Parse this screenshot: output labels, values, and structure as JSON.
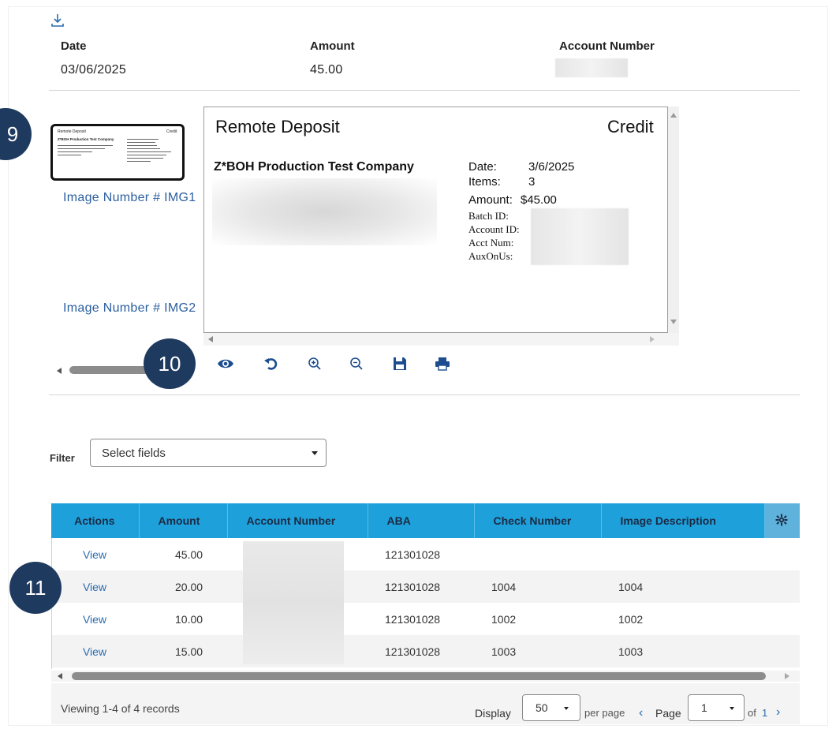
{
  "header": {
    "columns": [
      {
        "label": "Date",
        "value": "03/06/2025"
      },
      {
        "label": "Amount",
        "value": "45.00"
      },
      {
        "label": "Account Number",
        "value": ""
      }
    ]
  },
  "badges": {
    "b9": "9",
    "b10": "10",
    "b11": "11"
  },
  "images": {
    "link1": "Image Number # IMG1",
    "link2": "Image Number # IMG2"
  },
  "viewer": {
    "title": "Remote Deposit",
    "type": "Credit",
    "company": "Z*BOH Production Test Company",
    "fields": [
      {
        "label": "Date:",
        "value": "3/6/2025"
      },
      {
        "label": "Items:",
        "value": "3"
      },
      {
        "label": "Amount:",
        "value": "$45.00"
      }
    ],
    "extra_fields": [
      "Batch ID:",
      "Account ID:",
      "Acct Num:",
      "AuxOnUs:"
    ]
  },
  "thumbnail": {
    "title": "Remote Deposit",
    "type": "Credit",
    "company": "Z*BOH Production Test Company"
  },
  "toolbar": {
    "icons": [
      "eye-icon",
      "rotate-icon",
      "zoom-in-icon",
      "zoom-out-icon",
      "save-icon",
      "print-icon"
    ]
  },
  "filter": {
    "label": "Filter",
    "placeholder": "Select fields"
  },
  "table": {
    "headers": [
      "Actions",
      "Amount",
      "Account Number",
      "ABA",
      "Check Number",
      "Image Description"
    ],
    "rows": [
      {
        "action": "View",
        "amount": "45.00",
        "account": "",
        "aba": "121301028",
        "check": "",
        "desc": ""
      },
      {
        "action": "View",
        "amount": "20.00",
        "account": "",
        "aba": "121301028",
        "check": "1004",
        "desc": "1004"
      },
      {
        "action": "View",
        "amount": "10.00",
        "account": "",
        "aba": "121301028",
        "check": "1002",
        "desc": "1002"
      },
      {
        "action": "View",
        "amount": "15.00",
        "account": "",
        "aba": "121301028",
        "check": "1003",
        "desc": "1003"
      }
    ]
  },
  "pager": {
    "summary": "Viewing 1-4 of 4 records",
    "display_label": "Display",
    "page_size": "50",
    "per_page": "per page",
    "page_label": "Page",
    "page_value": "1",
    "of_label": "of",
    "total_pages": "1"
  },
  "colors": {
    "header_bg": "#1ea0db",
    "badge": "#1f3a5f",
    "link": "#2b6cb0"
  }
}
